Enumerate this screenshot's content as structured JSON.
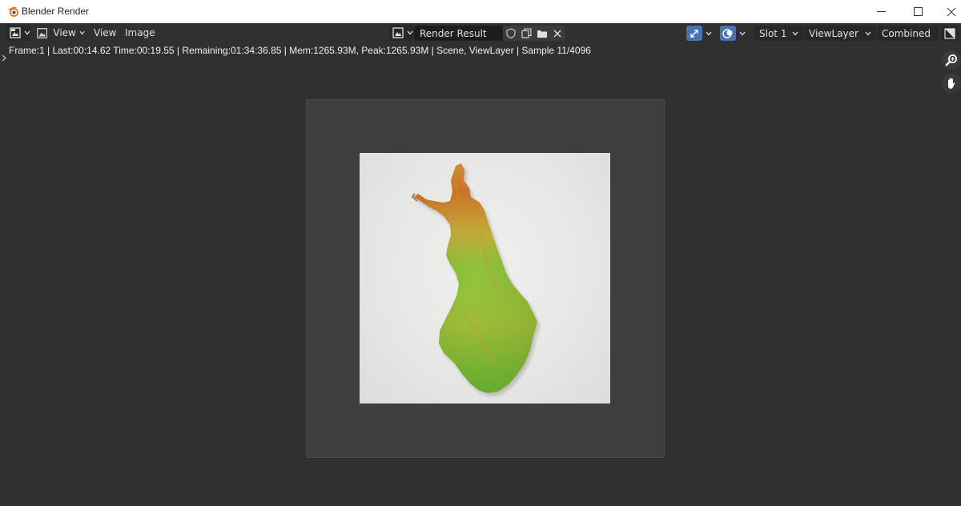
{
  "window": {
    "title": "Blender Render",
    "minimize_icon": "minimize-icon",
    "maximize_icon": "maximize-icon",
    "close_icon": "close-icon"
  },
  "header": {
    "editor_type_icon": "image-editor-icon",
    "mode_label": "View",
    "menus": [
      "View",
      "Image"
    ],
    "image_browse_icon": "image-browse-icon",
    "image_name": "Render Result",
    "image_actions": [
      "fake-user-icon",
      "duplicate-icon",
      "open-folder-icon",
      "unlink-icon"
    ],
    "gizmo_icon": "gizmo-icon",
    "overlay_icon": "overlay-icon",
    "slot": "Slot 1",
    "view_layer": "ViewLayer",
    "pass": "Combined",
    "display_channels_icon": "display-channels-icon"
  },
  "status": {
    "text": "Frame:1 | Last:00:14.62 Time:00:19.55 | Remaining:01:34:36.85 | Mem:1265.93M, Peak:1265.93M | Scene, ViewLayer | Sample 11/4096"
  },
  "navigation": {
    "zoom_icon": "zoom-icon",
    "pan_icon": "hand-pan-icon"
  },
  "render": {
    "subject": "terrain-map"
  },
  "colors": {
    "background": "#303030",
    "header": "#303030",
    "field": "#1d1d1d",
    "accent_blue": "#4772b3",
    "canvas_frame": "#3e3e3e",
    "terrain_low": "#7cc43a",
    "terrain_high": "#e08a2c"
  }
}
